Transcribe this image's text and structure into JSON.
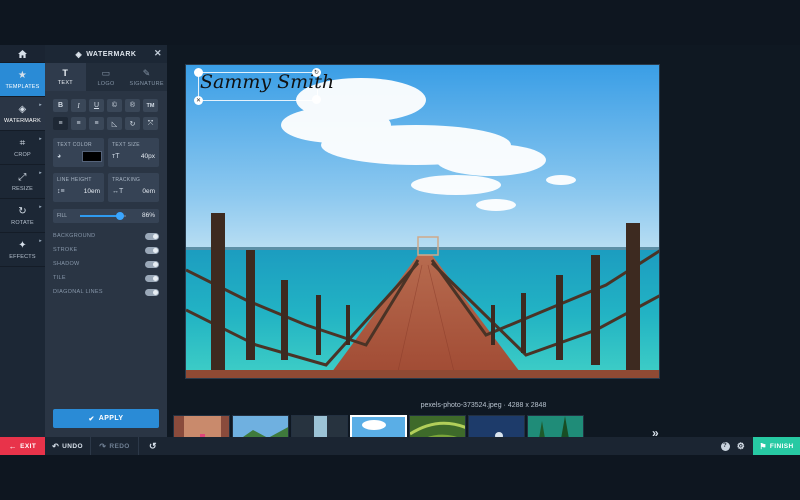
{
  "rail": {
    "items": [
      {
        "label": "TEMPLATES",
        "icon": "star-icon"
      },
      {
        "label": "WATERMARK",
        "icon": "layers-icon"
      },
      {
        "label": "CROP",
        "icon": "crop-icon"
      },
      {
        "label": "RESIZE",
        "icon": "resize-icon"
      },
      {
        "label": "ROTATE",
        "icon": "rotate-icon"
      },
      {
        "label": "EFFECTS",
        "icon": "magic-wand-icon"
      }
    ]
  },
  "panel": {
    "title": "WATERMARK",
    "tabs": [
      "TEXT",
      "LOGO",
      "SIGNATURE"
    ],
    "format_buttons": [
      "B",
      "I",
      "U",
      "C",
      "R",
      "TM"
    ],
    "text_color_label": "TEXT COLOR",
    "text_color_value": "#000000",
    "text_size_label": "TEXT SIZE",
    "text_size_value": "40px",
    "line_height_label": "LINE HEIGHT",
    "line_height_value": "10em",
    "tracking_label": "TRACKING",
    "tracking_value": "0em",
    "fill_label": "FILL",
    "fill_value": "86%",
    "fill_fraction": 0.86,
    "toggles": [
      "BACKGROUND",
      "STROKE",
      "SHADOW",
      "TILE",
      "DIAGONAL LINES"
    ],
    "apply_label": "APPLY"
  },
  "canvas": {
    "watermark_text": "Sammy Smith",
    "filename": "pexels-photo-373524.jpeg · 4288 x 2848"
  },
  "bottombar": {
    "exit": "EXIT",
    "undo": "UNDO",
    "redo": "REDO",
    "finish": "FINISH"
  },
  "colors": {
    "accent_blue": "#2a8bd6",
    "exit_red": "#e8334a",
    "finish_green": "#27c9a3"
  }
}
